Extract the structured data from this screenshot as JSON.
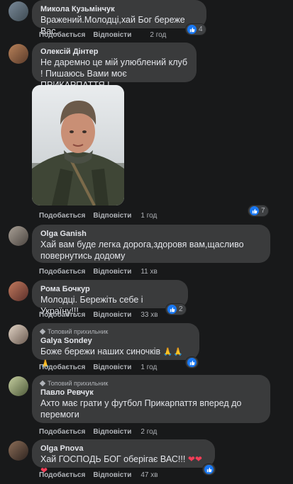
{
  "actions": {
    "like": "Подобається",
    "reply": "Відповісти"
  },
  "comments": [
    {
      "author": "Микола Кузьмінчук",
      "text": "Вражений.Молодці,хай Бог береже Вас.",
      "time": "2 год",
      "reactions": "4"
    },
    {
      "author": "Олексій Дінтер",
      "text": "Не даремно це мій улюблений клуб ! Пишаюсь Вами моє ПРИКАРПАТТЯ !",
      "time": "1 год",
      "reactions": "7"
    },
    {
      "author": "Olga Ganish",
      "text": "Хай вам буде легка дорога,здоровя вам,щасливо повернутись додому",
      "time": "11 хв",
      "reactions": ""
    },
    {
      "author": "Рома Бочкур",
      "text": "Молодці. Бережіть себе і Україну!!!",
      "time": "33 хв",
      "reactions": "2"
    },
    {
      "badge": "Топовий прихильник",
      "author": "Galya Sondey",
      "text": "Боже бережи наших синочків",
      "emoji": "🙏🙏🙏",
      "time": "1 год",
      "reactions": ""
    },
    {
      "badge": "Топовий прихильник",
      "author": "Павло Ревчук",
      "text": "Ахто має грати у футбол Прикарпаття вперед до перемоги",
      "time": "2 год",
      "reactions": ""
    },
    {
      "author": "Olga Pnova",
      "text": "Хай ГОСПОДЬ БОГ оберігає ВАС!!!",
      "emoji": "❤❤❤",
      "time": "47 хв",
      "reactions": ""
    }
  ],
  "colors": {
    "background": "#18191a",
    "bubble": "#3a3b3c",
    "like": "#1877f2",
    "heart": "#f33e58"
  },
  "icons": {
    "like": "thumbs-up-icon",
    "badge": "diamond-icon"
  }
}
